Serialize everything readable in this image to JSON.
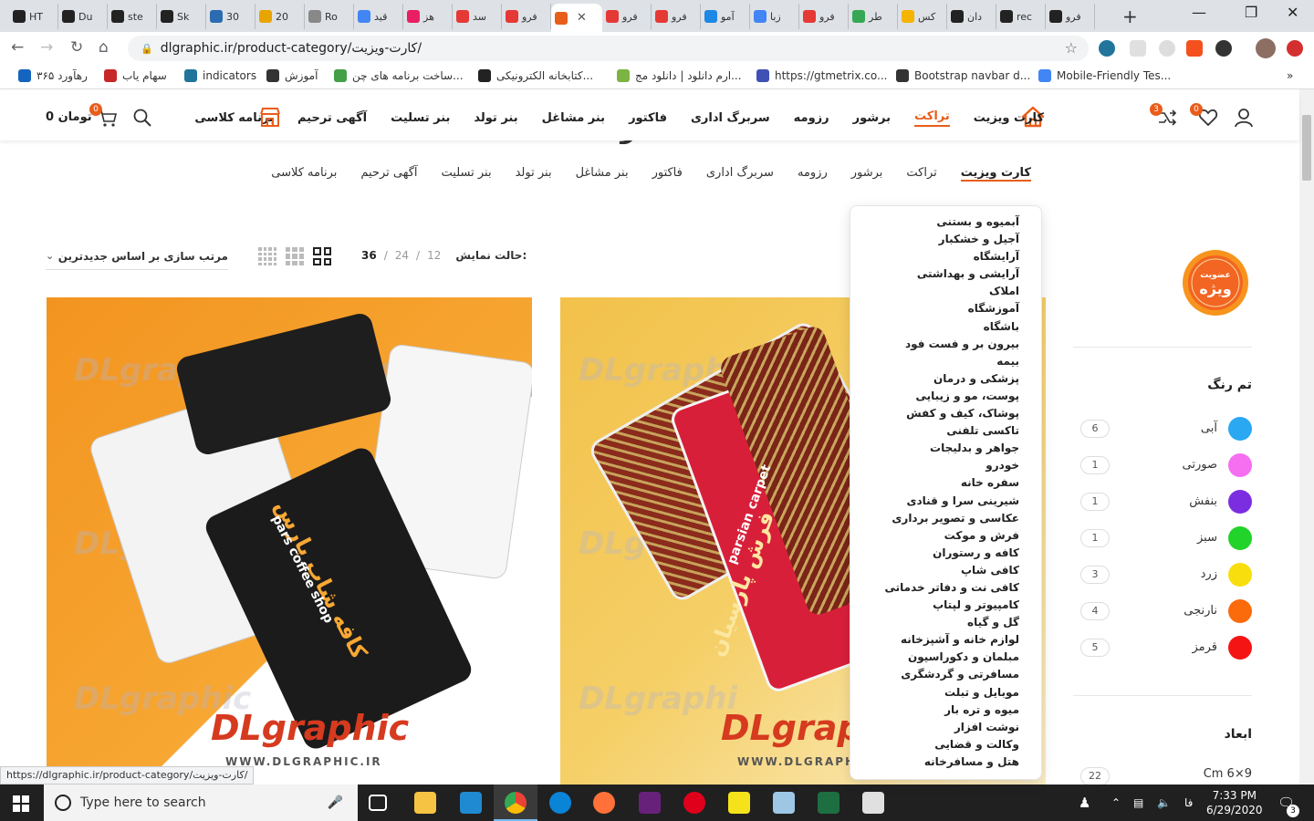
{
  "browser": {
    "tabs": [
      {
        "label": "HT",
        "color": "#222222"
      },
      {
        "label": "Du",
        "color": "#222222"
      },
      {
        "label": "ste",
        "color": "#222222"
      },
      {
        "label": "Sk",
        "color": "#222222"
      },
      {
        "label": "30",
        "color": "#2b6cb0"
      },
      {
        "label": "20",
        "color": "#e8a400"
      },
      {
        "label": "Ro",
        "color": "#888888"
      },
      {
        "label": "قید",
        "color": "#4285f4"
      },
      {
        "label": "هز",
        "color": "#e91e63"
      },
      {
        "label": "سد",
        "color": "#e53935"
      },
      {
        "label": "فرو",
        "color": "#e53935"
      },
      {
        "label": "",
        "color": "#e95d1a"
      },
      {
        "label": "فرو",
        "color": "#e53935"
      },
      {
        "label": "فرو",
        "color": "#e53935"
      },
      {
        "label": "آمو",
        "color": "#1e88e5"
      },
      {
        "label": "زبا",
        "color": "#4285f4"
      },
      {
        "label": "فرو",
        "color": "#e53935"
      },
      {
        "label": "طر",
        "color": "#34a853"
      },
      {
        "label": "کس",
        "color": "#f4b400"
      },
      {
        "label": "دان",
        "color": "#222222"
      },
      {
        "label": "rec",
        "color": "#222222"
      },
      {
        "label": "فرو",
        "color": "#222222"
      }
    ],
    "url": "dlgraphic.ir/product-category/کارت-ویزیت/",
    "status_url": "https://dlgraphic.ir/product-category/کارت-ویزیت/",
    "bookmarks": [
      {
        "label": "رهآورد ۳۶۵",
        "color": "#1565c0"
      },
      {
        "label": "سهام یاب",
        "color": "#c62828"
      },
      {
        "label": "indicators",
        "color": "#21759b"
      },
      {
        "label": "آموزش",
        "color": "#333333"
      },
      {
        "label": "ساخت برنامه های چن...",
        "color": "#43a047"
      },
      {
        "label": "کتابخانه الکترونیکی...",
        "color": "#222222"
      },
      {
        "label": "ارم دانلود | دانلود مج...",
        "color": "#7cb342"
      },
      {
        "label": "https://gtmetrix.co...",
        "color": "#3f51b5"
      },
      {
        "label": "Bootstrap navbar d...",
        "color": "#333333"
      },
      {
        "label": "Mobile-Friendly Tes...",
        "color": "#4285f4"
      }
    ]
  },
  "header": {
    "nav": [
      "کارت ویزیت",
      "تراکت",
      "برشور",
      "رزومه",
      "سربرگ اداری",
      "فاکتور",
      "بنر مشاغل",
      "بنر تولد",
      "بنر تسلیت",
      "آگهی ترحیم",
      "برنامه کلاسی"
    ],
    "active_nav": "تراکت",
    "cart_text": "0 تومان",
    "cart_count": "0",
    "wishlist_count": "0",
    "compare_count": "3",
    "accent": "#e95d1a"
  },
  "subnav": [
    "کارت ویزیت",
    "تراکت",
    "برشور",
    "رزومه",
    "سربرگ اداری",
    "فاکتور",
    "بنر مشاغل",
    "بنر تولد",
    "بنر تسلیت",
    "آگهی ترحیم",
    "برنامه کلاسی"
  ],
  "toolbar": {
    "sort_label": "مرتب سازی بر اساس جدیدترین",
    "show_label": "حالت نمایش:",
    "per_page": [
      "12",
      "24",
      "36"
    ],
    "per_page_sep": "/"
  },
  "dropdown_items": [
    "آبمیوه و بستنی",
    "آجیل و خشکبار",
    "آرایشگاه",
    "آرایشی و بهداشتی",
    "املاک",
    "آموزشگاه",
    "باشگاه",
    "بیرون بر و فست فود",
    "بیمه",
    "پزشکی و درمان",
    "پوست، مو و زیبایی",
    "پوشاک، کیف و کفش",
    "تاکسی تلفنی",
    "جواهر و بدلیجات",
    "خودرو",
    "سفره خانه",
    "شیرینی سرا و قنادی",
    "عکاسی و تصویر برداری",
    "فرش و موکت",
    "کافه و رستوران",
    "کافی شاپ",
    "کافی نت و دفاتر خدماتی",
    "کامپیوتر و لپتاپ",
    "گل و گیاه",
    "لوازم خانه و آشپزخانه",
    "مبلمان و دکوراسیون",
    "مسافرتی و گردشگری",
    "موبایل و تبلت",
    "میوه و تره بار",
    "نوشت افزار",
    "وکالت و قضایی",
    "هتل و مسافرخانه"
  ],
  "sidebar": {
    "vip_text_top": "عضویت",
    "vip_text": "ویژه",
    "color_title": "تم رنگ",
    "colors": [
      {
        "name": "آبی",
        "count": "6",
        "hex": "#2aa8f2"
      },
      {
        "name": "صورتی",
        "count": "1",
        "hex": "#f56ff0"
      },
      {
        "name": "بنفش",
        "count": "1",
        "hex": "#7b2ee0"
      },
      {
        "name": "سبز",
        "count": "1",
        "hex": "#22d32a"
      },
      {
        "name": "زرد",
        "count": "3",
        "hex": "#f8de0c"
      },
      {
        "name": "نارنجی",
        "count": "4",
        "hex": "#fb6b0c"
      },
      {
        "name": "قرمز",
        "count": "5",
        "hex": "#f51414"
      }
    ],
    "size_title": "ابعاد",
    "size_name": "Cm 6×9",
    "size_count": "22"
  },
  "products": [
    {
      "card_fa": "کافه شاپ پارس",
      "card_en": "pars coffee shop",
      "brand": "DLgraphic",
      "brand_url": "WWW.DLGRAPHIC.IR"
    },
    {
      "card_fa": "فرش پارسیان",
      "card_en": "parsian carpet",
      "brand": "DLgraphi",
      "brand_url": "WWW.DLGRAPHI"
    }
  ],
  "taskbar": {
    "search_placeholder": "Type here to search",
    "time": "7:33 PM",
    "date": "6/29/2020",
    "lang": "فا",
    "notif_count": "3"
  }
}
